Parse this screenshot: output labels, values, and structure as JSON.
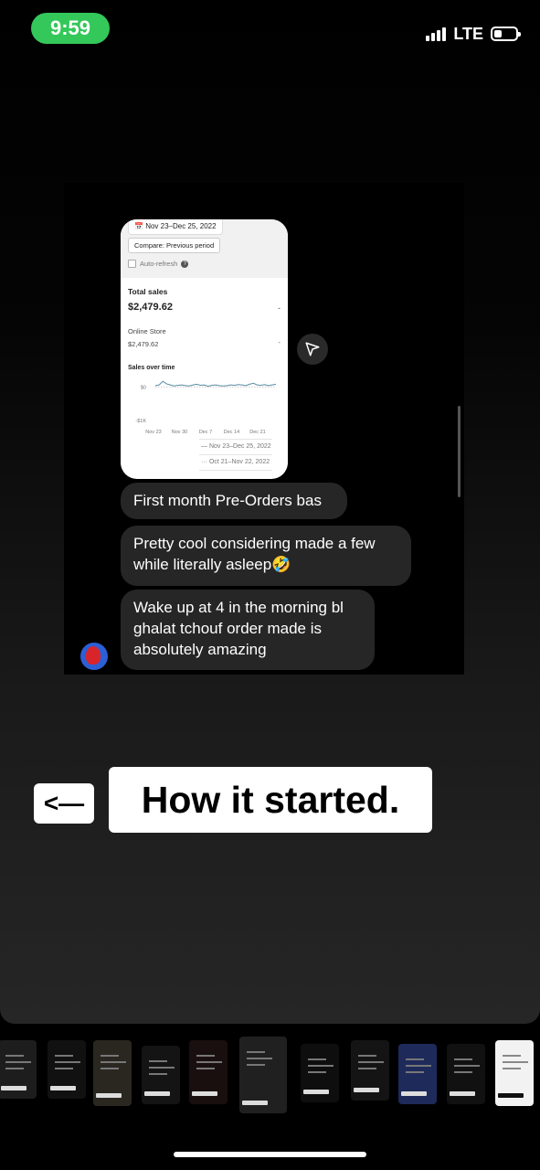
{
  "status_bar": {
    "time": "9:59",
    "network": "LTE"
  },
  "shared_post": {
    "date_range": "Nov 23–Dec 25, 2022",
    "compare_button": "Compare: Previous period",
    "auto_refresh": "Auto-refresh",
    "total_sales_label": "Total sales",
    "total_sales_value": "$2,479.62",
    "total_dash": "-",
    "channel_label": "Online Store",
    "channel_value": "$2,479.62",
    "channel_dash": "-",
    "chart_title": "Sales over time"
  },
  "chart_data": {
    "type": "line",
    "title": "Sales over time",
    "xlabel": "",
    "ylabel": "",
    "x_tick_labels": [
      "Nov 23",
      "Nov 30",
      "Dec 7",
      "Dec 14",
      "Dec 21"
    ],
    "y_tick_labels": [
      "$0",
      "-$1K"
    ],
    "ylim": [
      -1000,
      200
    ],
    "series": [
      {
        "name": "Nov 23–Dec 25, 2022",
        "color": "#5b8fa8",
        "values": [
          40,
          60,
          170,
          90,
          60,
          30,
          50,
          60,
          40,
          30,
          60,
          80,
          50,
          60,
          20,
          50,
          60,
          40,
          30,
          40,
          60,
          50,
          70,
          60,
          40,
          80,
          110,
          60,
          50,
          70,
          40,
          60,
          80
        ]
      },
      {
        "name": "Oct 21–Nov 22, 2022",
        "color": "#c9c9c9",
        "values": [
          0,
          0,
          0,
          0,
          0,
          0,
          0,
          0,
          0,
          0,
          0,
          0,
          0,
          0,
          0,
          0,
          0,
          0,
          0,
          0,
          0,
          0,
          0,
          0,
          0,
          0,
          0,
          0,
          0,
          0,
          0,
          0,
          0
        ]
      }
    ],
    "legend": [
      "Nov 23–Dec 25, 2022",
      "Oct 21–Nov 22, 2022"
    ],
    "legend_position": "bottom-right",
    "grid": false
  },
  "messages": [
    {
      "text": "First month Pre-Orders bas"
    },
    {
      "text": "Pretty cool considering made a few while literally asleep🤣"
    },
    {
      "text": "Wake up at 4 in the morning bl ghalat tchouf order made is absolutely amazing"
    }
  ],
  "overlay": {
    "back_arrow": "<—",
    "caption": "How it started."
  },
  "icons": {
    "share": "send-icon",
    "signal": "signal-bars-icon",
    "battery": "battery-icon"
  },
  "colors": {
    "time_pill": "#34c759",
    "bubble": "#262626",
    "chart_line": "#5b8fa8"
  }
}
